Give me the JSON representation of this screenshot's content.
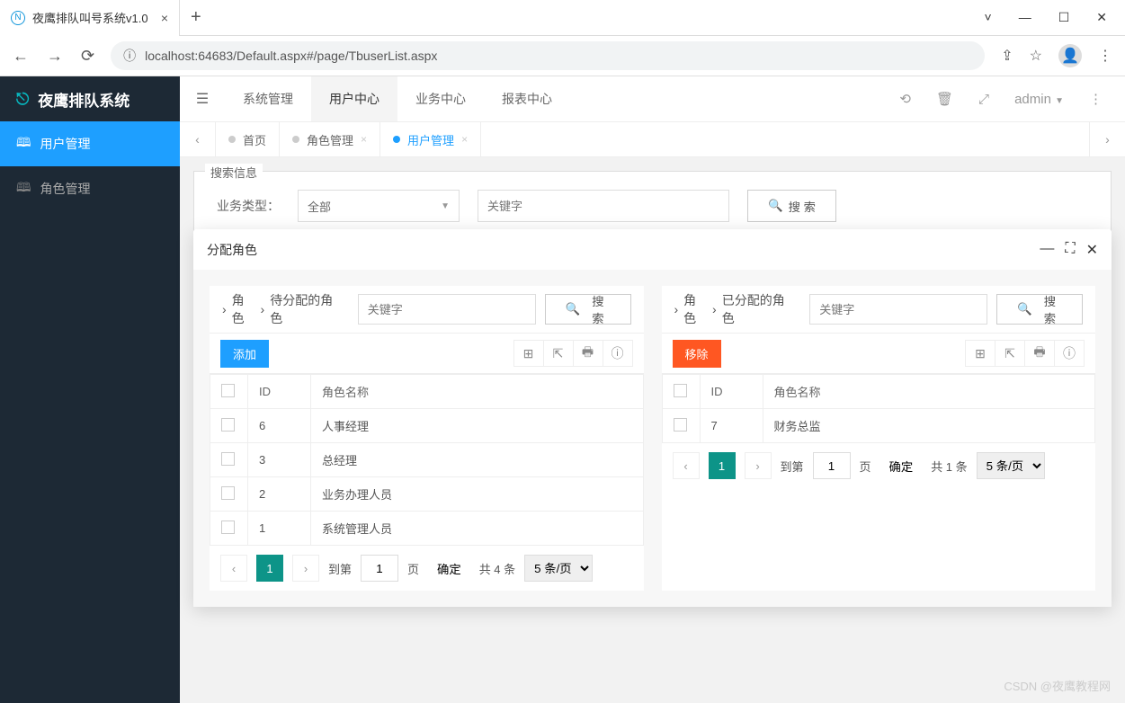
{
  "browser": {
    "tab_title": "夜鹰排队叫号系统v1.0",
    "url": "localhost:64683/Default.aspx#/page/TbuserList.aspx"
  },
  "app": {
    "logo_text": "夜鹰排队系统",
    "sidebar": {
      "items": [
        {
          "label": "用户管理",
          "active": true
        },
        {
          "label": "角色管理",
          "active": false
        }
      ]
    },
    "topnav": {
      "items": [
        {
          "label": "系统管理",
          "active": false
        },
        {
          "label": "用户中心",
          "active": true
        },
        {
          "label": "业务中心",
          "active": false
        },
        {
          "label": "报表中心",
          "active": false
        }
      ],
      "user": "admin"
    },
    "page_tabs": [
      {
        "label": "首页",
        "active": false,
        "closable": false
      },
      {
        "label": "角色管理",
        "active": false,
        "closable": true
      },
      {
        "label": "用户管理",
        "active": true,
        "closable": true
      }
    ]
  },
  "search_panel": {
    "legend": "搜索信息",
    "type_label": "业务类型：",
    "type_value": "全部",
    "keyword_placeholder": "关键字",
    "search_btn": "搜 索"
  },
  "modal": {
    "title": "分配角色",
    "left": {
      "crumb1": "角色",
      "crumb2": "待分配的角色",
      "keyword_placeholder": "关键字",
      "search_btn": "搜 索",
      "action_btn": "添加",
      "columns": {
        "id": "ID",
        "name": "角色名称"
      },
      "rows": [
        {
          "id": "6",
          "name": "人事经理"
        },
        {
          "id": "3",
          "name": "总经理"
        },
        {
          "id": "2",
          "name": "业务办理人员"
        },
        {
          "id": "1",
          "name": "系统管理人员"
        }
      ],
      "pager": {
        "page": "1",
        "goto_label": "到第",
        "goto_value": "1",
        "page_unit": "页",
        "confirm": "确定",
        "total": "共 4 条",
        "per": "5 条/页"
      }
    },
    "right": {
      "crumb1": "角色",
      "crumb2": "已分配的角色",
      "keyword_placeholder": "关键字",
      "search_btn": "搜 索",
      "action_btn": "移除",
      "columns": {
        "id": "ID",
        "name": "角色名称"
      },
      "rows": [
        {
          "id": "7",
          "name": "财务总监"
        }
      ],
      "pager": {
        "page": "1",
        "goto_label": "到第",
        "goto_value": "1",
        "page_unit": "页",
        "confirm": "确定",
        "total": "共 1 条",
        "per": "5 条/页"
      }
    }
  },
  "watermark": "CSDN @夜鹰教程网"
}
